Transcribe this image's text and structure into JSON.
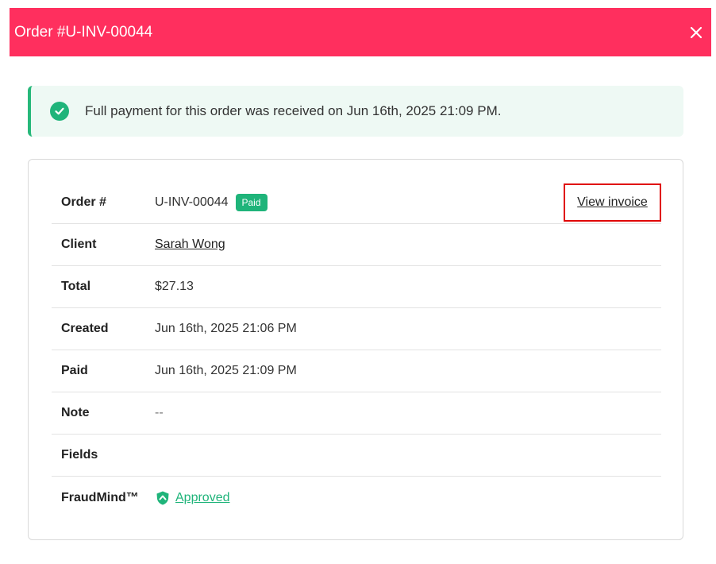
{
  "colors": {
    "header_bg": "#ff2f5e",
    "alert_bg": "#eef9f4",
    "alert_border": "#27b87a",
    "success_green": "#1fb47a",
    "highlight_red": "#e00000"
  },
  "header": {
    "title": "Order #U-INV-00044",
    "close_icon": "close-icon"
  },
  "alert": {
    "icon": "check-circle-icon",
    "message": "Full payment for this order was received on Jun 16th, 2025 21:09 PM."
  },
  "details": {
    "order": {
      "label": "Order #",
      "value": "U-INV-00044",
      "badge": "Paid",
      "action": "View invoice"
    },
    "client": {
      "label": "Client",
      "value": "Sarah Wong"
    },
    "total": {
      "label": "Total",
      "value": "$27.13"
    },
    "created": {
      "label": "Created",
      "value": "Jun 16th, 2025 21:06 PM"
    },
    "paid": {
      "label": "Paid",
      "value": "Jun 16th, 2025 21:09 PM"
    },
    "note": {
      "label": "Note",
      "value": "--"
    },
    "fields": {
      "label": "Fields",
      "value": ""
    },
    "fraud": {
      "label": "FraudMind™",
      "icon": "shield-icon",
      "value": "Approved"
    }
  }
}
